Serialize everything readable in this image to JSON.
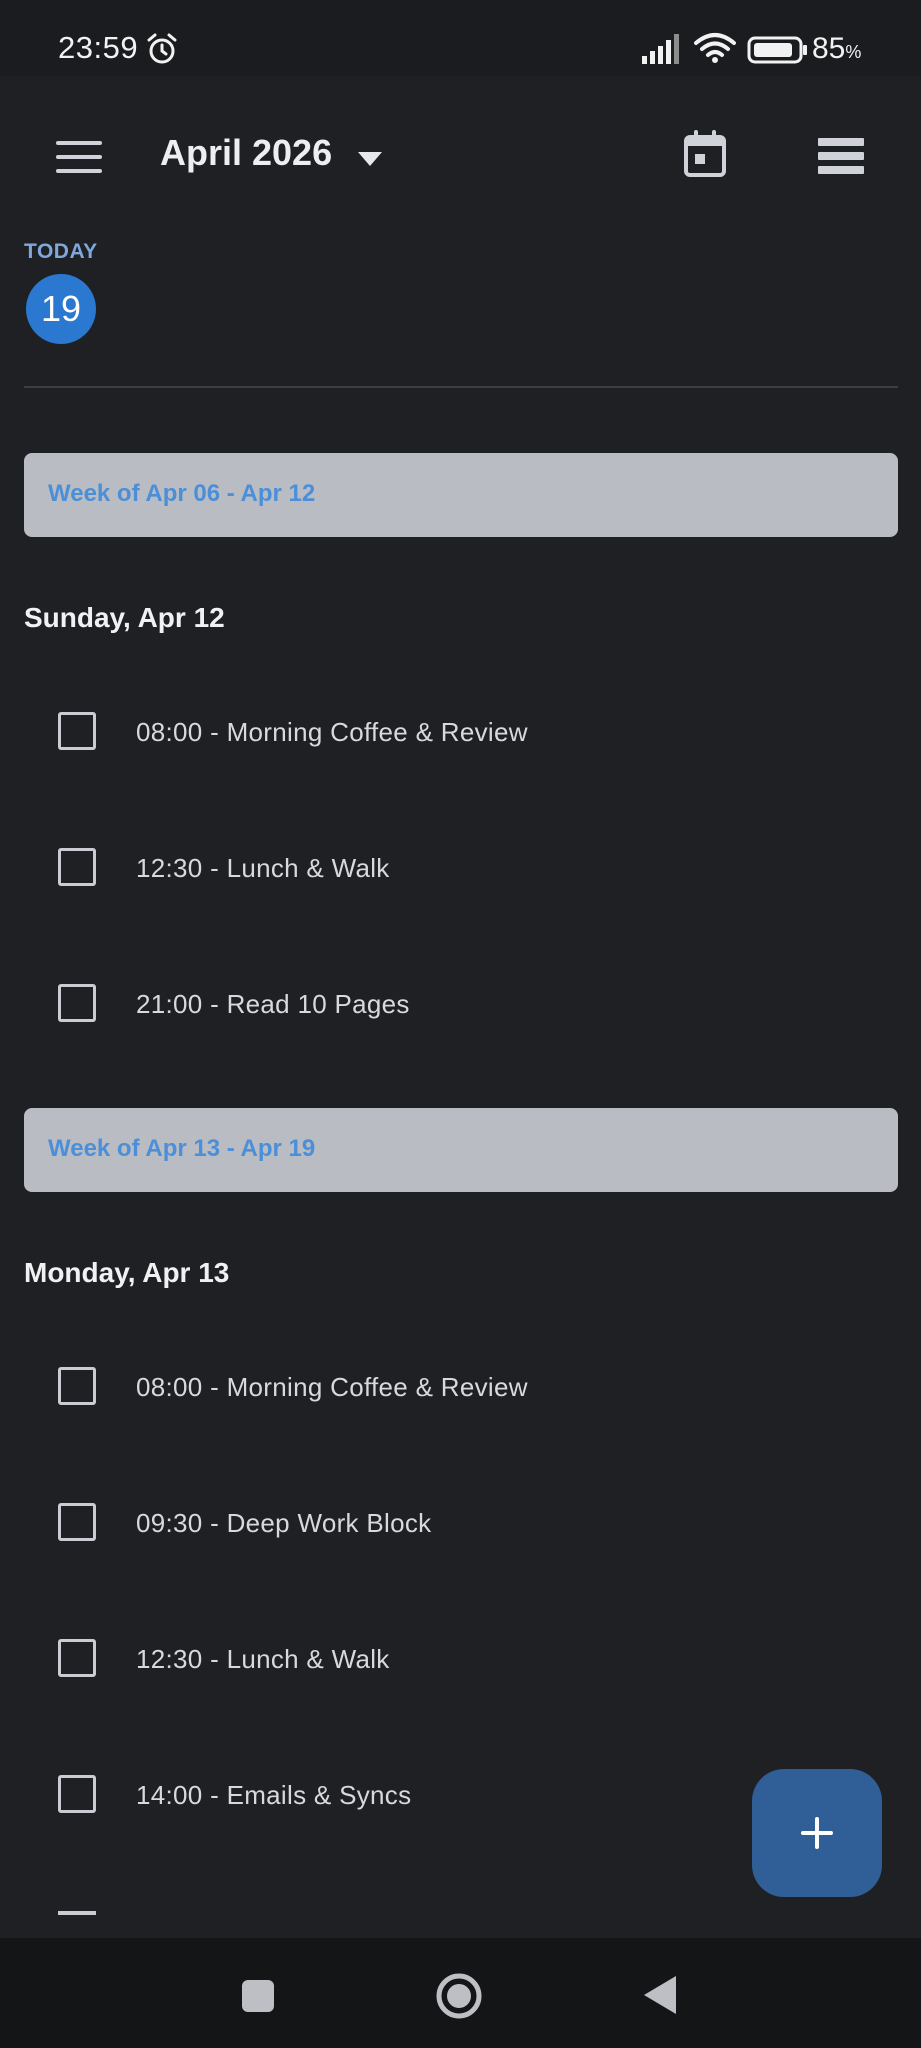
{
  "status_bar": {
    "time": "23:59",
    "battery": "85",
    "battery_unit": "%",
    "icons": [
      "alarm-icon",
      "signal-icon",
      "wifi-icon",
      "battery-icon"
    ]
  },
  "app_bar": {
    "title": "April 2026",
    "icons": [
      "menu-icon",
      "dropdown-icon",
      "calendar-icon",
      "view-icon"
    ]
  },
  "today": {
    "label": "TODAY",
    "day": "19"
  },
  "agenda": {
    "weeks": [
      {
        "label": "Week of Apr 06 - Apr 12",
        "days": [
          {
            "label": "Sunday, Apr 12",
            "tasks": [
              {
                "label": "08:00 - Morning Coffee & Review",
                "done": false
              },
              {
                "label": "12:30 - Lunch & Walk",
                "done": false
              },
              {
                "label": "21:00 - Read 10 Pages",
                "done": false
              }
            ]
          }
        ]
      },
      {
        "label": "Week of Apr 13 - Apr 19",
        "days": [
          {
            "label": "Monday, Apr 13",
            "tasks": [
              {
                "label": "08:00 - Morning Coffee & Review",
                "done": false
              },
              {
                "label": "09:30 - Deep Work Block",
                "done": false
              },
              {
                "label": "12:30 - Lunch & Walk",
                "done": false
              },
              {
                "label": "14:00 - Emails & Syncs",
                "done": false
              }
            ]
          }
        ]
      }
    ]
  },
  "fab": {
    "icon": "plus-icon"
  },
  "nav_bar": {
    "icons": [
      "recents-icon",
      "home-icon",
      "back-icon"
    ]
  },
  "colors": {
    "background": "#1f2024",
    "accent": "#2a78cf",
    "week_header_bg": "#b9bcc3",
    "week_header_text": "#4b8fd8",
    "fab": "#2f5f96"
  }
}
